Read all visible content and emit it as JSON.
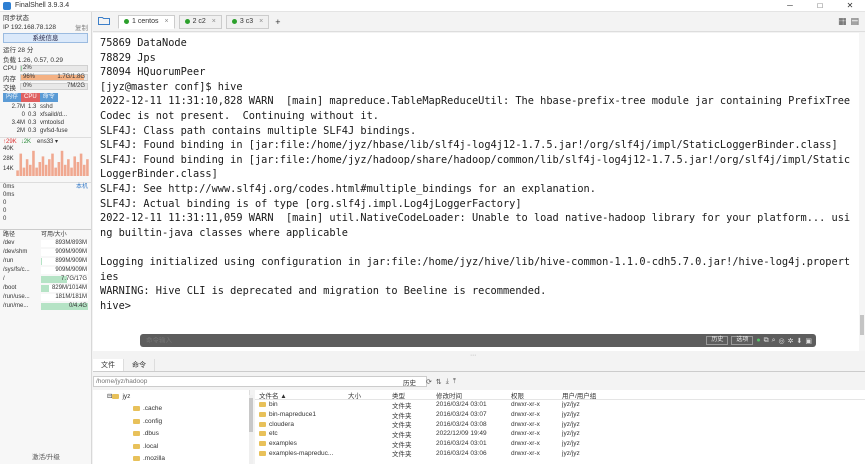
{
  "app": {
    "title": "FinalShell 3.9.3.4"
  },
  "window_controls": {
    "minimize": "─",
    "maximize": "□",
    "close": "✕"
  },
  "sidebar": {
    "sync_label": "同步状态",
    "ip_label": "IP 192.168.78.128",
    "copy_label": "复制",
    "sysinfo_button": "系统信息",
    "uptime": "运行 28 分",
    "load": "负载 1.26, 0.57, 0.29",
    "cpu": {
      "label": "CPU",
      "percent_text": "2%",
      "percent": 2
    },
    "mem": {
      "label": "内存",
      "percent_text": "96%",
      "detail": "1.7G/1.8G",
      "percent": 96
    },
    "swap": {
      "label": "交换",
      "percent_text": "0%",
      "detail": "7M/2G",
      "percent": 0
    },
    "proc_tabs": [
      "内存",
      "CPU",
      "命令"
    ],
    "processes": [
      {
        "mem": "2.7M",
        "cpu": "1.3",
        "name": "sshd"
      },
      {
        "mem": "0",
        "cpu": "0.3",
        "name": "xfsaild/d..."
      },
      {
        "mem": "3.4M",
        "cpu": "0.3",
        "name": "vmtoolsd"
      },
      {
        "mem": "2M",
        "cpu": "0.3",
        "name": "gvfsd-fuse"
      }
    ],
    "net": {
      "up": "↑29K",
      "down": "↓2K",
      "iface": "ens33 ▾",
      "ticks": [
        "40K",
        "28K",
        "14K"
      ],
      "series": [
        0.2,
        0.8,
        0.3,
        0.6,
        0.4,
        0.9,
        0.3,
        0.5,
        0.7,
        0.4,
        0.6,
        0.8,
        0.3,
        0.5,
        0.9,
        0.4,
        0.6,
        0.3,
        0.7,
        0.5,
        0.8,
        0.4,
        0.6
      ]
    },
    "ping": {
      "label": "0ms",
      "host": "本机",
      "values": [
        "0ms",
        "0",
        "0",
        "0"
      ]
    },
    "disk_header": {
      "path": "路径",
      "avail": "可用/大小"
    },
    "disks": [
      {
        "path": "/dev",
        "text": "893M/893M",
        "used": 0.0
      },
      {
        "path": "/dev/shm",
        "text": "909M/909M",
        "used": 0.0
      },
      {
        "path": "/run",
        "text": "899M/909M",
        "used": 0.01
      },
      {
        "path": "/sys/fs/c...",
        "text": "909M/909M",
        "used": 0.0
      },
      {
        "path": "/",
        "text": "7.7G/17G",
        "used": 0.55
      },
      {
        "path": "/boot",
        "text": "829M/1014M",
        "used": 0.18
      },
      {
        "path": "/run/use...",
        "text": "181M/181M",
        "used": 0.0
      },
      {
        "path": "/run/me...",
        "text": "0/4.4G",
        "used": 1.0
      }
    ],
    "upgrade": "激活/升级"
  },
  "tabs": {
    "items": [
      {
        "label": "1 centos",
        "active": true
      },
      {
        "label": "2 c2",
        "active": false
      },
      {
        "label": "3 c3",
        "active": false
      }
    ],
    "add": "+",
    "close": "×"
  },
  "terminal": {
    "lines": [
      "75869 DataNode",
      "78829 Jps",
      "78094 HQuorumPeer",
      "[jyz@master conf]$ hive",
      "2022-12-11 11:31:10,828 WARN  [main] mapreduce.TableMapReduceUtil: The hbase-prefix-tree module jar containing PrefixTree",
      "Codec is not present.  Continuing without it.",
      "SLF4J: Class path contains multiple SLF4J bindings.",
      "SLF4J: Found binding in [jar:file:/home/jyz/hbase/lib/slf4j-log4j12-1.7.5.jar!/org/slf4j/impl/StaticLoggerBinder.class]",
      "SLF4J: Found binding in [jar:file:/home/jyz/hadoop/share/hadoop/common/lib/slf4j-log4j12-1.7.5.jar!/org/slf4j/impl/Static",
      "LoggerBinder.class]",
      "SLF4J: See http://www.slf4j.org/codes.html#multiple_bindings for an explanation.",
      "SLF4J: Actual binding is of type [org.slf4j.impl.Log4jLoggerFactory]",
      "2022-12-11 11:31:11,059 WARN  [main] util.NativeCodeLoader: Unable to load native-hadoop library for your platform... usi",
      "ng builtin-java classes where applicable",
      "",
      "Logging initialized using configuration in jar:file:/home/jyz/hive/lib/hive-common-1.1.0-cdh5.7.0.jar!/hive-log4j.propert",
      "ies",
      "WARNING: Hive CLI is deprecated and migration to Beeline is recommended.",
      "hive>"
    ]
  },
  "cmdbar": {
    "placeholder": "命令输入",
    "history": "历史",
    "options": "选项"
  },
  "bottom_tabs": [
    "文件",
    "命令"
  ],
  "filebrowser": {
    "path": "/home/jyz/hadoop",
    "history": "历史",
    "tree": [
      ".cache",
      ".config",
      ".dbus",
      ".local",
      ".mozilla"
    ],
    "tree_root": "jyz",
    "columns": {
      "name": "文件名 ▲",
      "size": "大小",
      "type": "类型",
      "mtime": "修改时间",
      "perm": "权限",
      "owner": "用户/用户组"
    },
    "files": [
      {
        "name": "bin",
        "type": "文件夹",
        "mtime": "2016/03/24 03:01",
        "perm": "drwxr-xr-x",
        "owner": "jyz/jyz"
      },
      {
        "name": "bin-mapreduce1",
        "type": "文件夹",
        "mtime": "2016/03/24 03:07",
        "perm": "drwxr-xr-x",
        "owner": "jyz/jyz"
      },
      {
        "name": "cloudera",
        "type": "文件夹",
        "mtime": "2016/03/24 03:08",
        "perm": "drwxr-xr-x",
        "owner": "jyz/jyz"
      },
      {
        "name": "etc",
        "type": "文件夹",
        "mtime": "2022/12/09 19:49",
        "perm": "drwxr-xr-x",
        "owner": "jyz/jyz"
      },
      {
        "name": "examples",
        "type": "文件夹",
        "mtime": "2016/03/24 03:01",
        "perm": "drwxr-xr-x",
        "owner": "jyz/jyz"
      },
      {
        "name": "examples-mapreduc...",
        "type": "文件夹",
        "mtime": "2016/03/24 03:06",
        "perm": "drwxr-xr-x",
        "owner": "jyz/jyz"
      }
    ]
  }
}
